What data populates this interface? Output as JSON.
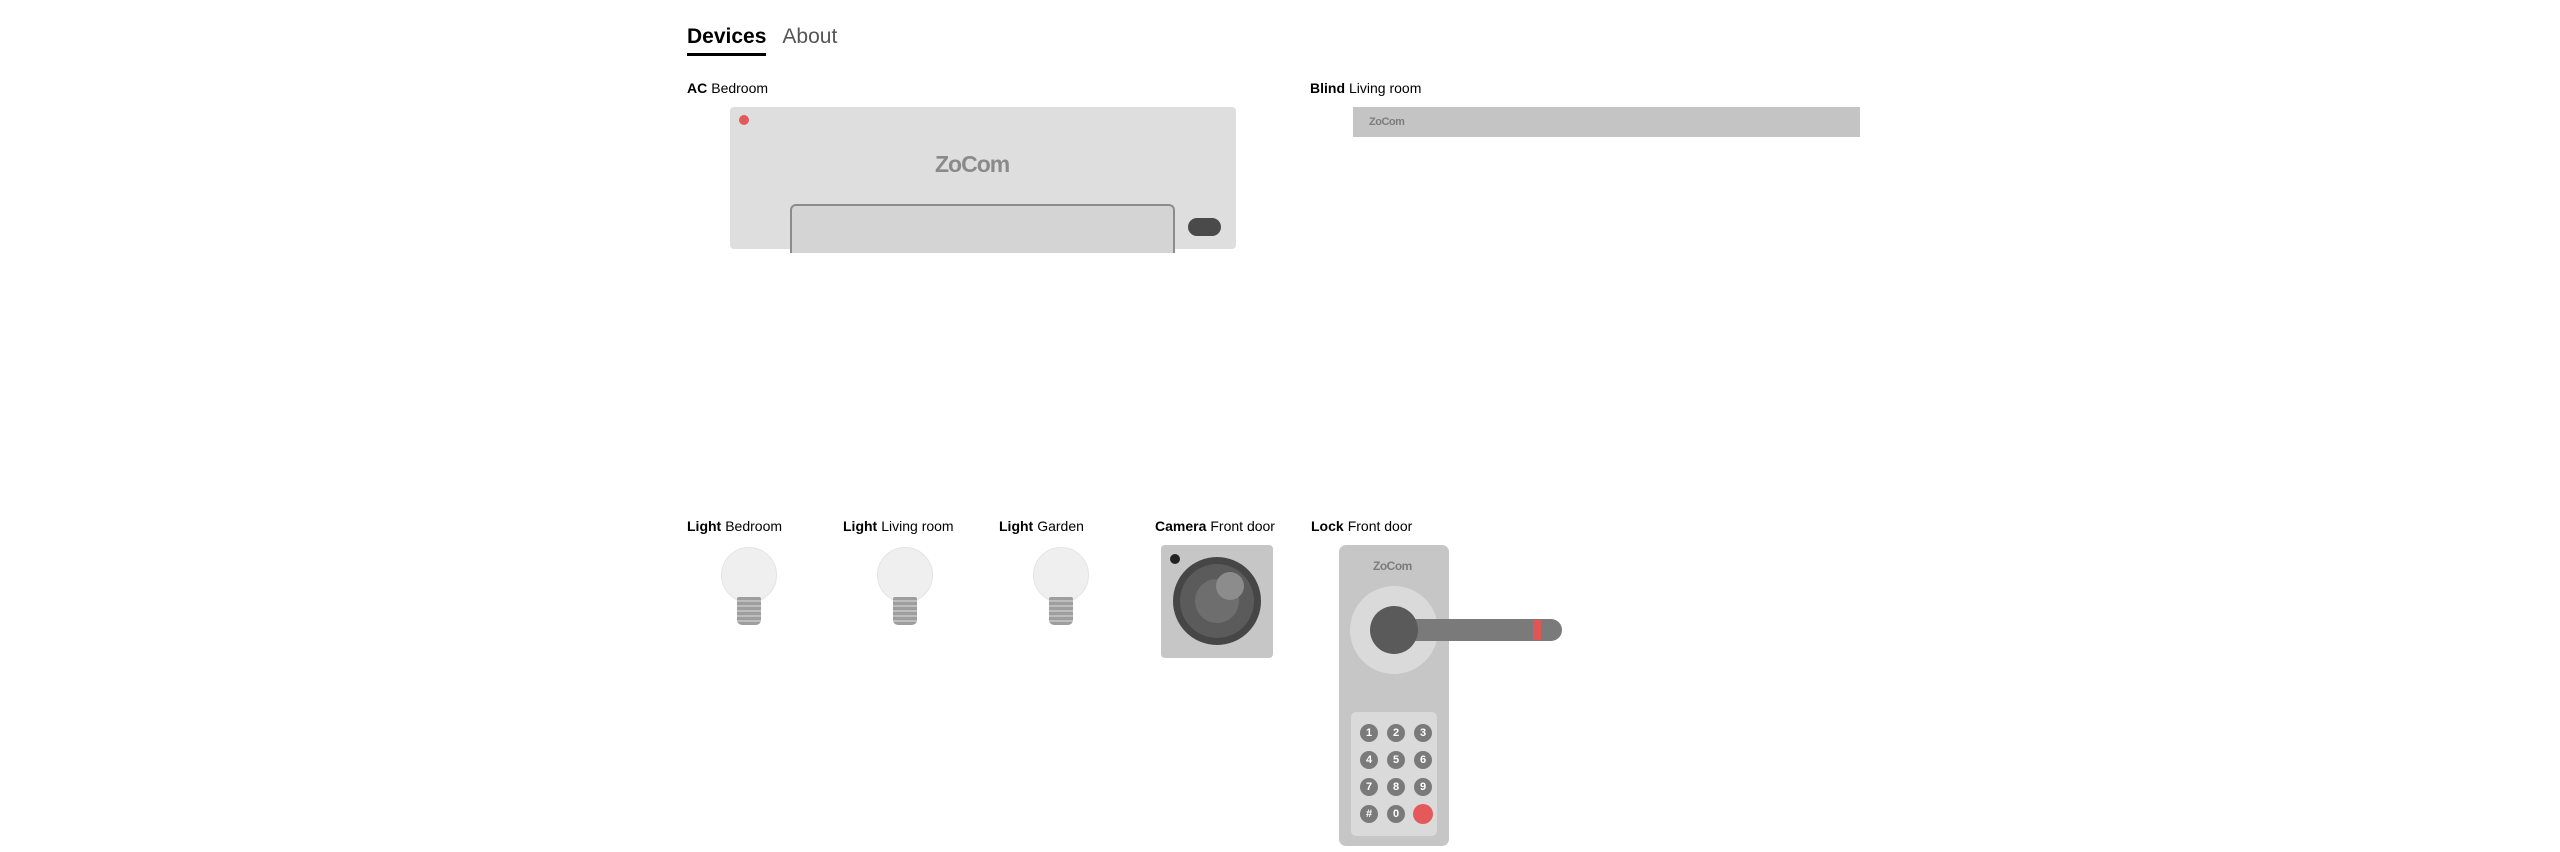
{
  "nav": {
    "tabs": [
      {
        "label": "Devices"
      },
      {
        "label": "About"
      }
    ]
  },
  "devices": {
    "ac": {
      "type": "AC",
      "room": "Bedroom",
      "brand": "ZoCom"
    },
    "blind": {
      "type": "Blind",
      "room": "Living room",
      "brand": "ZoCom"
    },
    "light_bedroom": {
      "type": "Light",
      "room": "Bedroom"
    },
    "light_living": {
      "type": "Light",
      "room": "Living room"
    },
    "light_garden": {
      "type": "Light",
      "room": "Garden"
    },
    "camera": {
      "type": "Camera",
      "room": "Front door"
    },
    "lock": {
      "type": "Lock",
      "room": "Front door",
      "brand": "ZoCom",
      "keys": [
        "1",
        "2",
        "3",
        "4",
        "5",
        "6",
        "7",
        "8",
        "9",
        "#",
        "0",
        ""
      ]
    }
  },
  "colors": {
    "accent_red": "#e45a5a",
    "device_grey": "#c6c6c6"
  },
  "icons": {
    "bulb": "light-bulb-icon",
    "camera": "camera-lens-icon",
    "lock": "door-handle-icon"
  }
}
